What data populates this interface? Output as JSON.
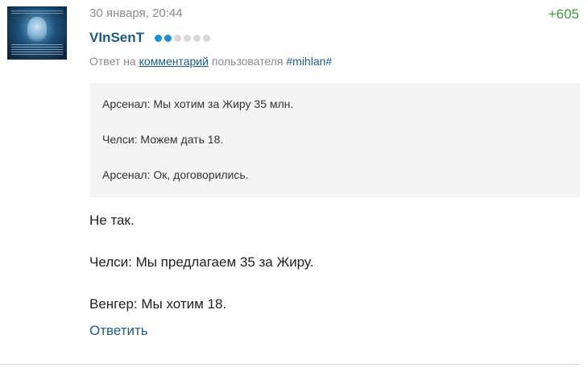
{
  "comment": {
    "timestamp": "30 января, 20:44",
    "rating": "+605",
    "author": "VInSenT",
    "level_dots_filled": 2,
    "level_dots_total": 6,
    "reply_prefix": "Ответ на",
    "reply_link": "комментарий",
    "reply_middle": "пользователя",
    "reply_user": "#mihlan#",
    "quote_lines": [
      "Арсенал: Мы хотим за Жиру 35 млн.",
      "Челси: Можем дать 18.",
      "Арсенал: Ок, договорились."
    ],
    "body_lines": [
      "Не так.",
      "Челси: Мы предлагаем 35 за Жиру.",
      "Венгер: Мы хотим 18."
    ],
    "reply_button": "Ответить"
  },
  "colors": {
    "link": "#1a5c82",
    "rating_positive": "#3c9a3c",
    "muted_text": "#8a8a8a",
    "quote_background": "#f4f4f4",
    "level_dot_active": "#1d8fcf",
    "level_dot_inactive": "#d8d8d8"
  }
}
